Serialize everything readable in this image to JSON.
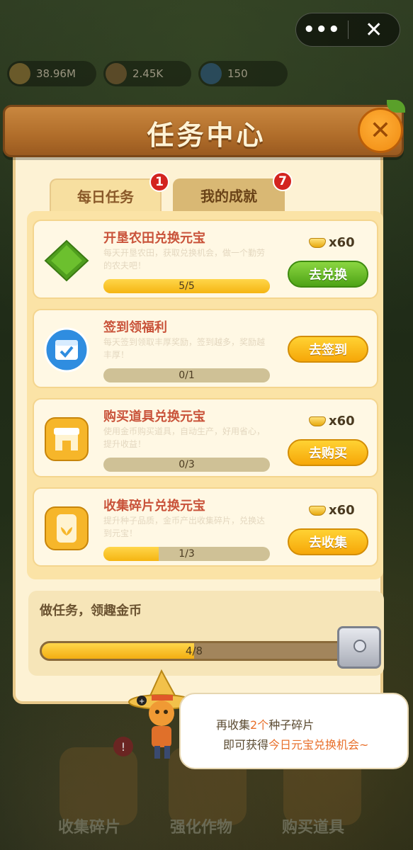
{
  "capsule": {
    "more": "•••",
    "close": "✕"
  },
  "resources": [
    "38.96M",
    "2.45K",
    "150"
  ],
  "panel": {
    "title": "任务中心"
  },
  "tabs": [
    {
      "label": "每日任务",
      "badge": "1"
    },
    {
      "label": "我的成就",
      "badge": "7"
    }
  ],
  "tasks": [
    {
      "title": "开垦农田兑换元宝",
      "desc": "每天开垦农田，获取兑换机会，做一个勤劳的农夫吧！",
      "progress_text": "5/5",
      "progress": 1.0,
      "reward": "x60",
      "button": "去兑换",
      "button_style": "green",
      "icon": "diamond-field-icon"
    },
    {
      "title": "签到领福利",
      "desc": "每天签到领取丰厚奖励，签到越多，奖励越丰厚！",
      "progress_text": "0/1",
      "progress": 0.0,
      "reward": "",
      "button": "去签到",
      "button_style": "yellow",
      "icon": "calendar-icon"
    },
    {
      "title": "购买道具兑换元宝",
      "desc": "使用金币购买道具，自动生产，好用省心，提升收益！",
      "progress_text": "0/3",
      "progress": 0.0,
      "reward": "x60",
      "button": "去购买",
      "button_style": "yellow",
      "icon": "shop-icon"
    },
    {
      "title": "收集碎片兑换元宝",
      "desc": "提升种子品质，金币产出收集碎片，兑换达到元宝！",
      "progress_text": "1/3",
      "progress": 0.33,
      "reward": "x60",
      "button": "去收集",
      "button_style": "yellow",
      "icon": "seed-jar-icon"
    }
  ],
  "overall": {
    "title": "做任务，领趣金币",
    "progress_text": "4/8",
    "progress": 0.5
  },
  "dock": [
    {
      "label": "收集碎片",
      "badge": "!"
    },
    {
      "label": "强化作物"
    },
    {
      "label": "购买道具"
    }
  ],
  "speech": {
    "l1_pre": "再收集",
    "l1_hl": "2个",
    "l1_post": "种子碎片",
    "l2_pre": "即可获得",
    "l2_hl": "今日元宝兑换机会~"
  },
  "colors": {
    "accent": "#c9533a",
    "green_button": "#4ea316",
    "yellow_button": "#f6a708",
    "badge": "#d3241f"
  }
}
